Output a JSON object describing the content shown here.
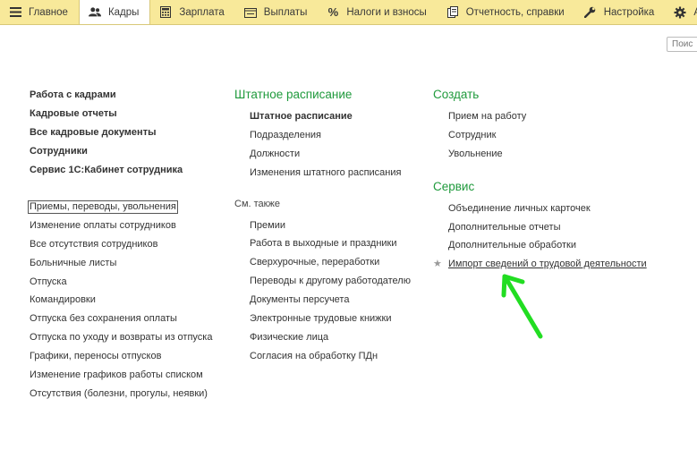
{
  "menu": {
    "tabs": [
      {
        "label": "Главное",
        "icon": "hamburger-icon"
      },
      {
        "label": "Кадры",
        "icon": "people-icon"
      },
      {
        "label": "Зарплата",
        "icon": "calculator-icon"
      },
      {
        "label": "Выплаты",
        "icon": "wallet-icon"
      },
      {
        "label": "Налоги и взносы",
        "icon": "percent-icon"
      },
      {
        "label": "Отчетность, справки",
        "icon": "documents-icon"
      },
      {
        "label": "Настройка",
        "icon": "wrench-icon"
      },
      {
        "label": "А",
        "icon": "gear-icon"
      }
    ],
    "active_tab": "Кадры",
    "active_color": "#ffffff",
    "bar_color": "#f8e99a"
  },
  "search": {
    "placeholder": "Поис"
  },
  "col1": {
    "main_links": [
      "Работа с кадрами",
      "Кадровые отчеты",
      "Все кадровые документы",
      "Сотрудники",
      "Сервис 1С:Кабинет сотрудника"
    ],
    "links": [
      "Приемы, переводы, увольнения",
      "Изменение оплаты сотрудников",
      "Все отсутствия сотрудников",
      "Больничные листы",
      "Отпуска",
      "Командировки",
      "Отпуска без сохранения оплаты",
      "Отпуска по уходу и возвраты из отпуска",
      "Графики, переносы отпусков",
      "Изменение графиков работы списком",
      "Отсутствия (болезни, прогулы, неявки)"
    ]
  },
  "col2": {
    "title": "Штатное расписание",
    "items": [
      "Штатное расписание",
      "Подразделения",
      "Должности",
      "Изменения штатного расписания"
    ],
    "see_also_label": "См. также",
    "see_also": [
      "Премии",
      "Работа в выходные и праздники",
      "Сверхурочные, переработки",
      "Переводы к другому работодателю",
      "Документы персучета",
      "Электронные трудовые книжки",
      "Физические лица",
      "Согласия на обработку ПДн"
    ]
  },
  "col3": {
    "create_title": "Создать",
    "create_items": [
      "Прием на работу",
      "Сотрудник",
      "Увольнение"
    ],
    "service_title": "Сервис",
    "service_items": [
      "Объединение личных карточек",
      "Дополнительные отчеты",
      "Дополнительные обработки",
      "Импорт сведений о трудовой деятельности"
    ]
  },
  "colors": {
    "section_title": "#1f9a3c",
    "arrow": "#22dd22"
  }
}
